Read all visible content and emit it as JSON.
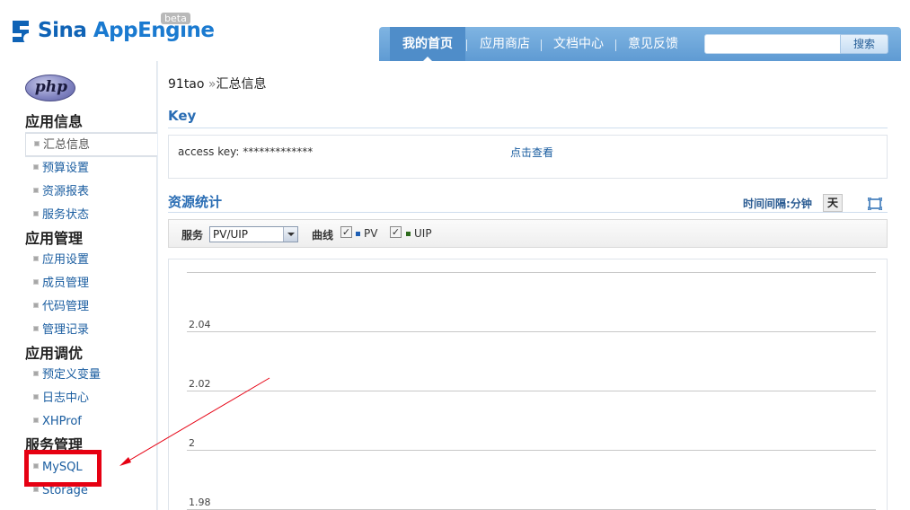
{
  "header": {
    "logo_text_a": "Sina ",
    "logo_text_b": "AppEngine",
    "beta": "beta",
    "nav": [
      {
        "label": "我的首页",
        "active": true
      },
      {
        "label": "应用商店",
        "active": false
      },
      {
        "label": "文档中心",
        "active": false
      },
      {
        "label": "意见反馈",
        "active": false
      }
    ],
    "search_placeholder": "",
    "search_button": "搜索"
  },
  "sidebar": {
    "php_logo": "php",
    "sections": [
      {
        "title": "应用信息",
        "items": [
          "汇总信息",
          "预算设置",
          "资源报表",
          "服务状态"
        ]
      },
      {
        "title": "应用管理",
        "items": [
          "应用设置",
          "成员管理",
          "代码管理",
          "管理记录"
        ]
      },
      {
        "title": "应用调优",
        "items": [
          "预定义变量",
          "日志中心",
          "XHProf"
        ]
      },
      {
        "title": "服务管理",
        "items": [
          "MySQL",
          "Storage"
        ]
      }
    ],
    "selected": "汇总信息",
    "highlighted": "MySQL"
  },
  "content": {
    "breadcrumb_app": "91tao",
    "breadcrumb_sep": "»",
    "breadcrumb_page": "汇总信息",
    "key_title": "Key",
    "access_key_label": "access key: *************",
    "view_link": "点击查看",
    "stats_title": "资源统计",
    "interval_label": "时间间隔:",
    "interval_minute": "分钟",
    "interval_day": "天",
    "filter": {
      "service_label": "服务",
      "service_value": "PV/UIP",
      "curve_label": "曲线",
      "pv_label": "PV",
      "uip_label": "UIP",
      "pv_color": "#1f5fb4",
      "uip_color": "#2e6b1d"
    }
  },
  "chart_data": {
    "type": "line",
    "title": "",
    "xlabel": "",
    "ylabel": "",
    "grid": true,
    "y_ticks": [
      "2.04",
      "2.02",
      "2",
      "1.98"
    ],
    "y_tick_values": [
      2.04,
      2.02,
      2,
      1.98
    ],
    "ylim": [
      1.98,
      2.06
    ],
    "series": []
  },
  "colors": {
    "brand_blue": "#0f63b6",
    "nav_blue": "#5f9bd3",
    "link_blue": "#1a5da0",
    "highlight_red": "#e60012"
  }
}
